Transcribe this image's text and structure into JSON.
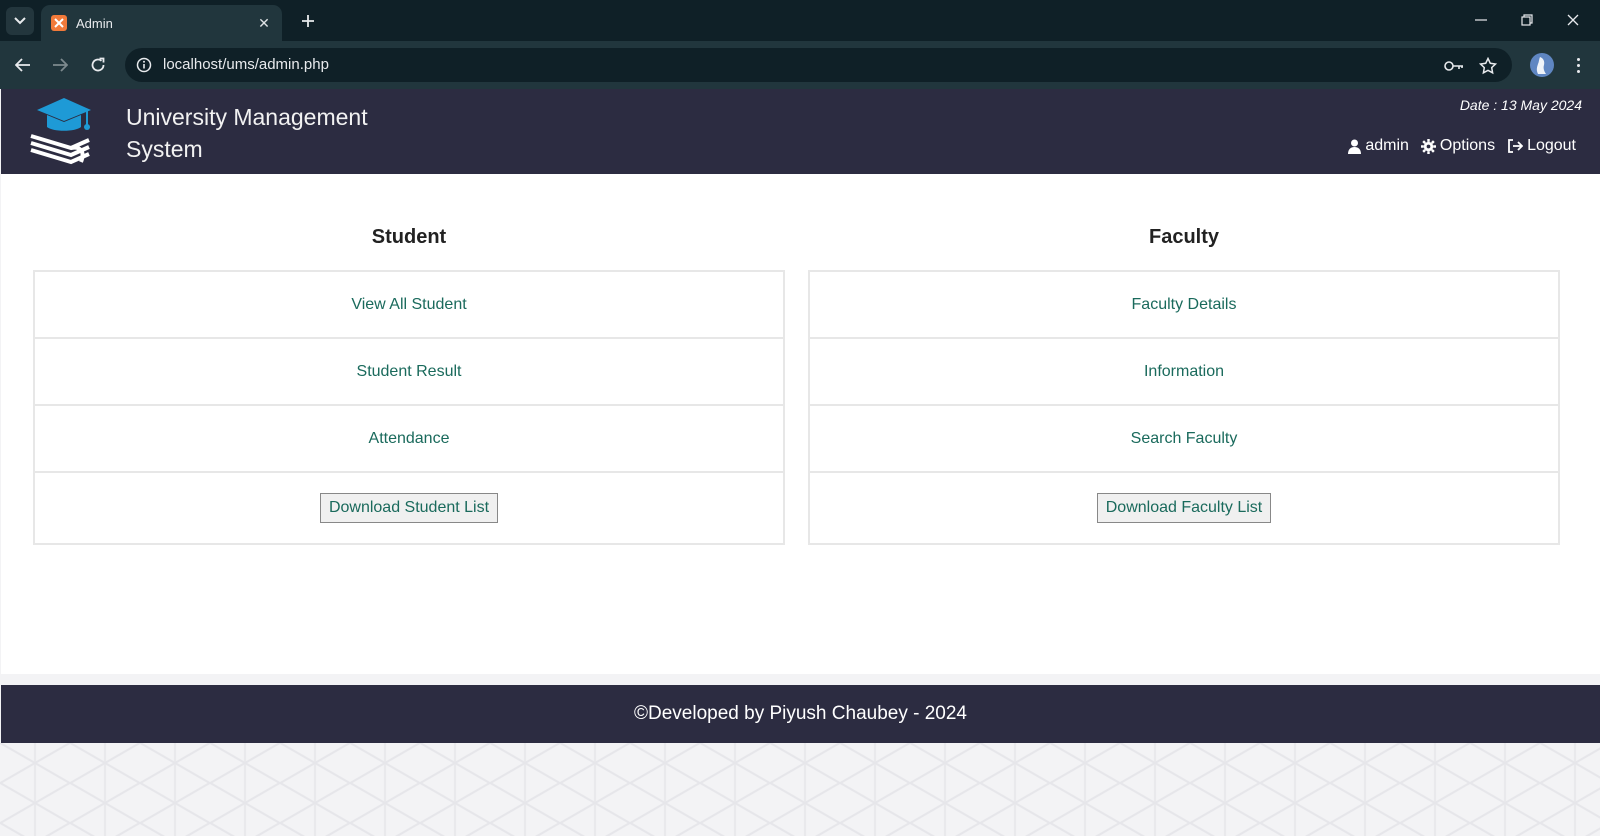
{
  "browser": {
    "tab_title": "Admin",
    "url": "localhost/ums/admin.php"
  },
  "header": {
    "title": "University Management System",
    "date": "Date : 13 May 2024",
    "nav": {
      "user": "admin",
      "options": "Options",
      "logout": "Logout"
    }
  },
  "student": {
    "heading": "Student",
    "items": [
      "View All Student",
      "Student Result",
      "Attendance"
    ],
    "download": "Download Student List"
  },
  "faculty": {
    "heading": "Faculty",
    "items": [
      "Faculty Details",
      "Information",
      "Search Faculty"
    ],
    "download": "Download Faculty List"
  },
  "footer": {
    "text": "©Developed by Piyush Chaubey - 2024"
  },
  "colors": {
    "header_bg": "#2c2c41",
    "link": "#1a6a5c",
    "browser_frame": "#0f2027",
    "logo_cap": "#1e9ad6"
  }
}
